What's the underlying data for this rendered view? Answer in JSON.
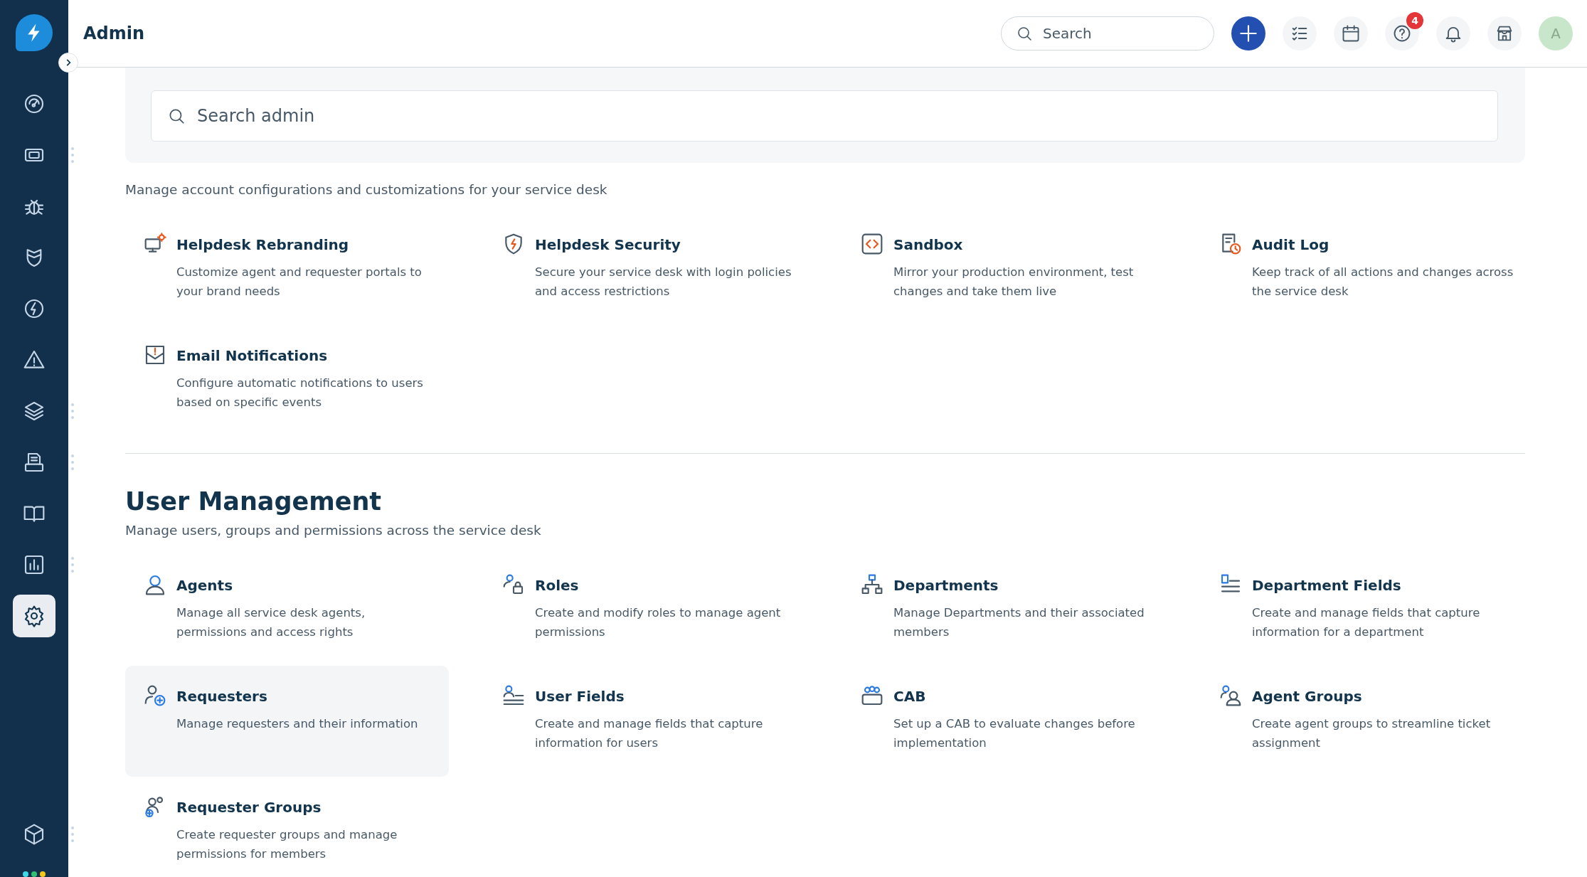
{
  "sidebar": {
    "items": [
      {
        "selected": false,
        "has_menu": false
      },
      {
        "selected": false,
        "has_menu": true
      },
      {
        "selected": false,
        "has_menu": false
      },
      {
        "selected": false,
        "has_menu": false
      },
      {
        "selected": false,
        "has_menu": false
      },
      {
        "selected": false,
        "has_menu": false
      },
      {
        "selected": false,
        "has_menu": true
      },
      {
        "selected": false,
        "has_menu": true
      },
      {
        "selected": false,
        "has_menu": false
      },
      {
        "selected": false,
        "has_menu": true
      },
      {
        "selected": true,
        "has_menu": false
      }
    ],
    "bottom_items": [
      {
        "selected": false,
        "has_menu": true
      }
    ],
    "status_dots": [
      {
        "color": "#3fd8e8"
      },
      {
        "color": "#2fbf71"
      },
      {
        "color": "#f5c518"
      }
    ]
  },
  "header": {
    "title": "Admin",
    "search": {
      "placeholder": "Search"
    },
    "help_badge": "4",
    "avatar": "A"
  },
  "admin_search": {
    "placeholder": "Search admin"
  },
  "sections": [
    {
      "description": "Manage account configurations and customizations for your service desk",
      "items": [
        {
          "title": "Helpdesk Rebranding",
          "description": "Customize agent and requester portals to your brand needs",
          "hovered": false
        },
        {
          "title": "Helpdesk Security",
          "description": "Secure your service desk with login policies and access restrictions",
          "hovered": false
        },
        {
          "title": "Sandbox",
          "description": "Mirror your production environment, test changes and take them live",
          "hovered": false
        },
        {
          "title": "Audit Log",
          "description": "Keep track of all actions and changes across the service desk",
          "hovered": false
        },
        {
          "title": "Email Notifications",
          "description": "Configure automatic notifications to users based on specific events",
          "hovered": false
        }
      ]
    },
    {
      "title": "User Management",
      "description": "Manage users, groups and permissions across the service desk",
      "items": [
        {
          "title": "Agents",
          "description": "Manage all service desk agents, permissions and access rights",
          "hovered": false
        },
        {
          "title": "Roles",
          "description": "Create and modify roles to manage agent permissions",
          "hovered": false
        },
        {
          "title": "Departments",
          "description": "Manage Departments and their associated members",
          "hovered": false
        },
        {
          "title": "Department Fields",
          "description": "Create and manage fields that capture information for a department",
          "hovered": false
        },
        {
          "title": "Requesters",
          "description": "Manage requesters and their information",
          "hovered": true
        },
        {
          "title": "User Fields",
          "description": "Create and manage fields that capture information for users",
          "hovered": false
        },
        {
          "title": "CAB",
          "description": "Set up a CAB to evaluate changes before implementation",
          "hovered": false
        },
        {
          "title": "Agent Groups",
          "description": "Create agent groups to streamline ticket assignment",
          "hovered": false
        },
        {
          "title": "Requester Groups",
          "description": "Create requester groups and manage permissions for members",
          "hovered": false
        }
      ]
    }
  ]
}
